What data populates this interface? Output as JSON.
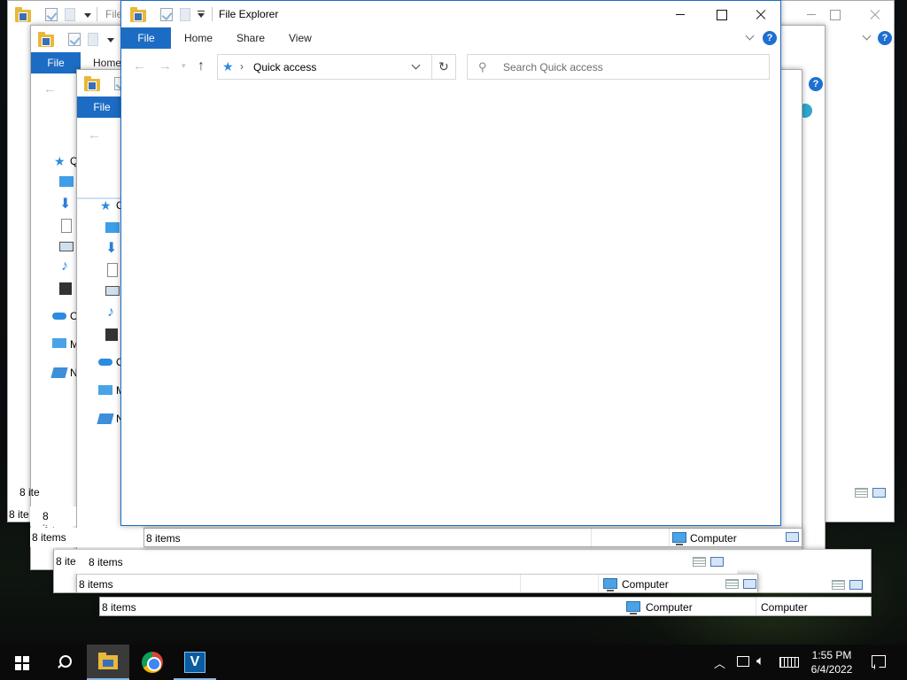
{
  "explorer": {
    "title": "File Explorer",
    "background_title": "File",
    "ribbon": {
      "file": "File",
      "home": "Home",
      "share": "Share",
      "view": "View",
      "help": "?"
    },
    "address": {
      "location": "Quick access",
      "separator": "›"
    },
    "search": {
      "placeholder": "Search Quick access"
    }
  },
  "background_windows": {
    "nav_truncated": {
      "quick": "Q",
      "onedrive": "O",
      "mypc": "M",
      "network": "N",
      "generic": "C"
    }
  },
  "status": {
    "items": "8 items",
    "items_truncated": "8 ite",
    "computer": "Computer"
  },
  "taskbar": {
    "time": "1:55 PM",
    "date": "6/4/2022",
    "v_app": "V"
  },
  "colors": {
    "accent": "#1c6cc4",
    "help": "#1e6fd0",
    "quick_access_star": "#2d8ae0",
    "taskbar": "#0a0a0a"
  },
  "icons": {
    "nav_pane": [
      "star-icon",
      "desktop-icon",
      "downloads-icon",
      "documents-icon",
      "pictures-icon",
      "music-icon",
      "videos-icon",
      "onedrive-icon",
      "this-pc-icon",
      "network-icon"
    ],
    "taskbar": [
      "windows-start-icon",
      "search-icon",
      "file-explorer-icon",
      "chrome-icon",
      "v-app-icon"
    ],
    "tray": [
      "chevron-up-icon",
      "network-icon",
      "volume-icon",
      "keyboard-icon",
      "notification-icon"
    ]
  }
}
